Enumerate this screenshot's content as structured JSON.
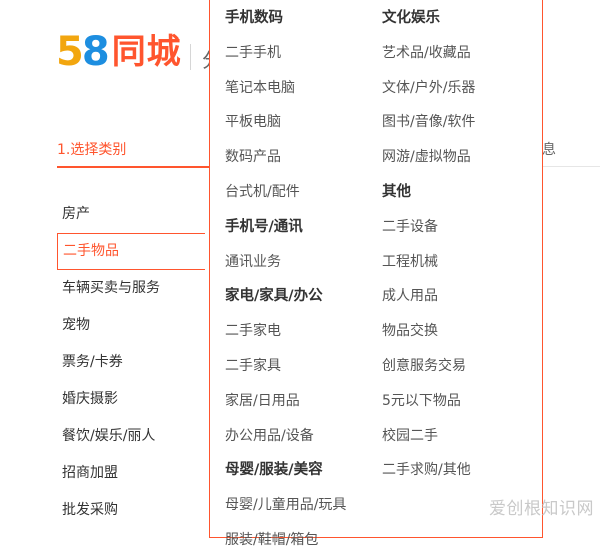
{
  "logo": {
    "digit_5": "5",
    "digit_8": "8",
    "text": "同城",
    "cut_text": "分"
  },
  "steps": {
    "current": "1.选择类别",
    "right_fragment": "息"
  },
  "sidebar": {
    "items": [
      {
        "label": "房产"
      },
      {
        "label": "二手物品"
      },
      {
        "label": "车辆买卖与服务"
      },
      {
        "label": "宠物"
      },
      {
        "label": "票务/卡券"
      },
      {
        "label": "婚庆摄影"
      },
      {
        "label": "餐饮/娱乐/丽人"
      },
      {
        "label": "招商加盟"
      },
      {
        "label": "批发采购"
      }
    ]
  },
  "dropdown": {
    "left_col": [
      {
        "type": "head",
        "label": "手机数码"
      },
      {
        "type": "item",
        "label": "二手手机"
      },
      {
        "type": "item",
        "label": "笔记本电脑"
      },
      {
        "type": "item",
        "label": "平板电脑"
      },
      {
        "type": "item",
        "label": "数码产品"
      },
      {
        "type": "item",
        "label": "台式机/配件"
      },
      {
        "type": "head",
        "label": "手机号/通讯"
      },
      {
        "type": "item",
        "label": "通讯业务"
      },
      {
        "type": "head",
        "label": "家电/家具/办公"
      },
      {
        "type": "item",
        "label": "二手家电"
      },
      {
        "type": "item",
        "label": "二手家具"
      },
      {
        "type": "item",
        "label": "家居/日用品"
      },
      {
        "type": "item",
        "label": "办公用品/设备"
      },
      {
        "type": "head",
        "label": "母婴/服装/美容"
      },
      {
        "type": "item",
        "label": "母婴/儿童用品/玩具"
      },
      {
        "type": "item",
        "label": "服装/鞋帽/箱包"
      }
    ],
    "right_col": [
      {
        "type": "head",
        "label": "文化娱乐"
      },
      {
        "type": "item",
        "label": "艺术品/收藏品"
      },
      {
        "type": "item",
        "label": "文体/户外/乐器"
      },
      {
        "type": "item",
        "label": "图书/音像/软件"
      },
      {
        "type": "item",
        "label": "网游/虚拟物品"
      },
      {
        "type": "head",
        "label": "其他"
      },
      {
        "type": "item",
        "label": "二手设备"
      },
      {
        "type": "item",
        "label": "工程机械"
      },
      {
        "type": "item",
        "label": "成人用品"
      },
      {
        "type": "item",
        "label": "物品交换"
      },
      {
        "type": "item",
        "label": "创意服务交易"
      },
      {
        "type": "item",
        "label": "5元以下物品"
      },
      {
        "type": "item",
        "label": "校园二手"
      },
      {
        "type": "item",
        "label": "二手求购/其他"
      }
    ]
  },
  "watermark": {
    "text": "爱创根知识网"
  },
  "colors": {
    "accent": "#ff552e",
    "logo_5": "#f2a60f",
    "logo_8": "#1d8ee0"
  }
}
